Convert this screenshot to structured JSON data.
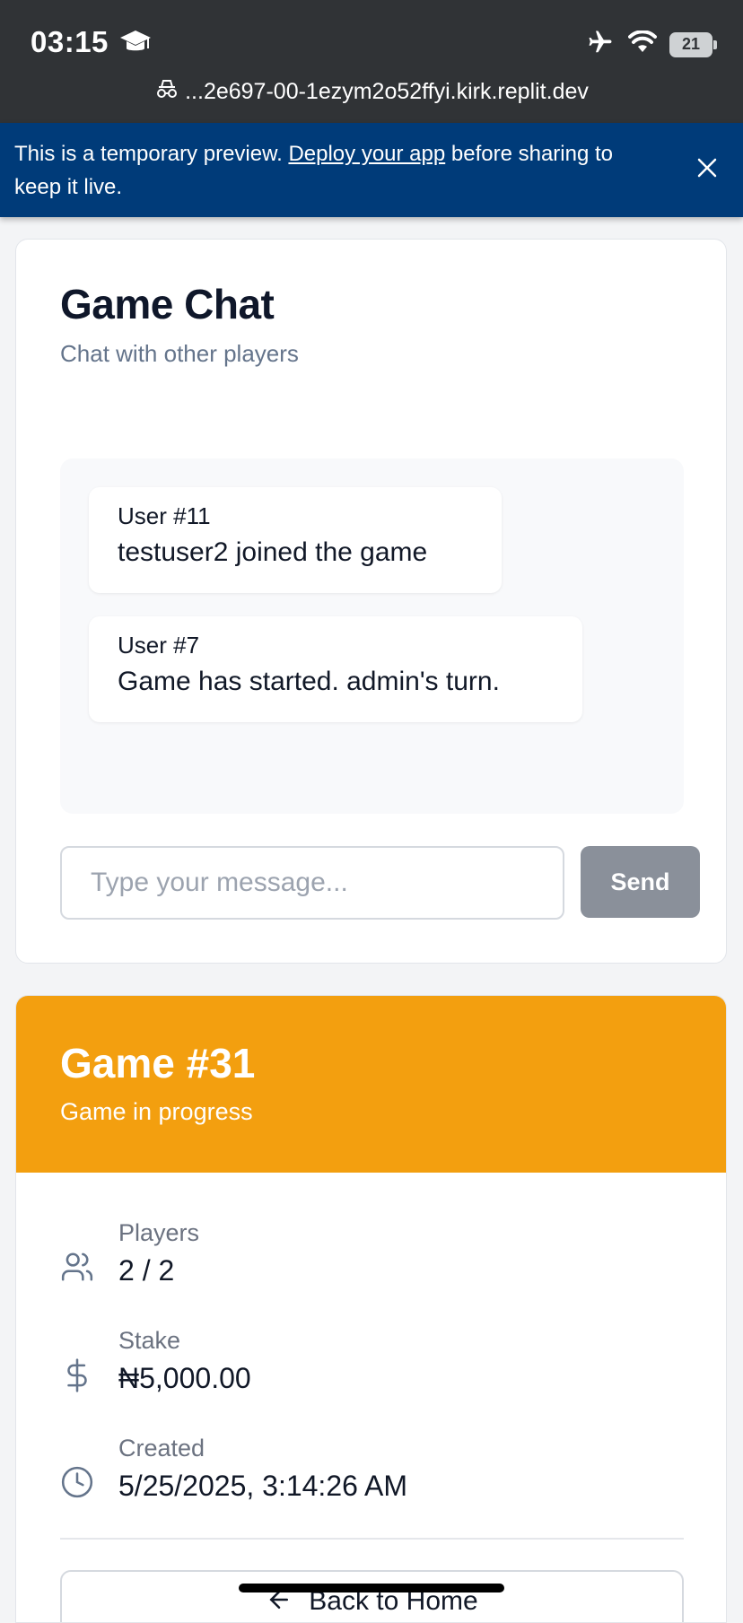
{
  "status_bar": {
    "time": "03:15",
    "battery": "21",
    "url": "...2e697-00-1ezym2o52ffyi.kirk.replit.dev"
  },
  "banner": {
    "text_before": "This is a temporary preview. ",
    "link": "Deploy your app",
    "text_after": " before sharing to keep it live."
  },
  "chat": {
    "title": "Game Chat",
    "subtitle": "Chat with other players",
    "messages": [
      {
        "user": "User #11",
        "text": "testuser2 joined the game"
      },
      {
        "user": "User #7",
        "text": "Game has started. admin's turn."
      }
    ],
    "input_placeholder": "Type your message...",
    "send_label": "Send"
  },
  "game": {
    "title": "Game #31",
    "status": "Game in progress",
    "header_color": "#f39f0f",
    "players_label": "Players",
    "players_value": "2 / 2",
    "stake_label": "Stake",
    "stake_value": "₦5,000.00",
    "created_label": "Created",
    "created_value": "5/25/2025, 3:14:26 AM",
    "back_label": "Back to Home"
  },
  "icons": [
    "graduation-cap-icon",
    "airplane-icon",
    "wifi-icon",
    "battery-icon",
    "incognito-icon",
    "close-icon",
    "users-icon",
    "dollar-icon",
    "clock-icon",
    "arrow-left-icon"
  ]
}
